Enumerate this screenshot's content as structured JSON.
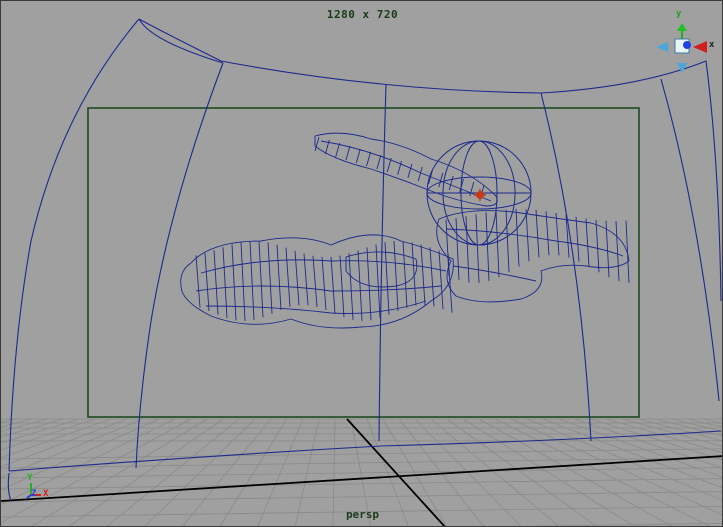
{
  "viewport": {
    "resolution_label": "1280 x 720",
    "camera_label": "persp"
  },
  "view_cube": {
    "axis_y": "y",
    "axis_x": "x",
    "icon": "view-cube-icon"
  },
  "axis_indicator": {
    "y": "Y",
    "z": "Z",
    "x": "X",
    "icon": "world-axis-icon"
  },
  "colors": {
    "background": "#a0a0a0",
    "grid": "#8a8a8a",
    "grid_axis": "#000000",
    "wireframe": "#1c2a8c",
    "resolution_gate": "#1e4a1e",
    "selection_pivot": "#c83a1a",
    "axis_x": "#d02020",
    "axis_y": "#20b020",
    "axis_z": "#2040e0"
  }
}
